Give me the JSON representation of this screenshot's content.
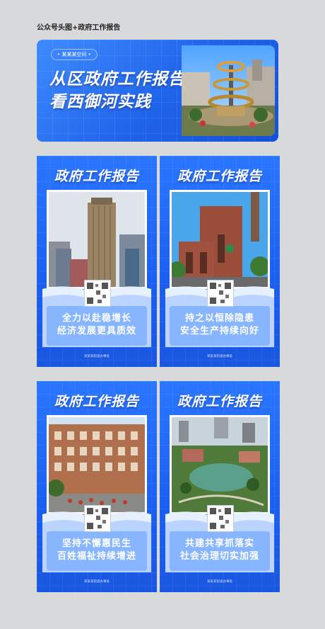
{
  "page_label": "公众号头图+政府工作报告",
  "banner": {
    "tag": "• 某某某空间 •",
    "title_line1": "从区政府工作报告",
    "title_line2": "看西御河实践"
  },
  "posters": [
    {
      "title": "政府工作报告",
      "line1": "全力以赴稳增长",
      "line2": "经济发展更具质效",
      "footer": "某某某街道办事处"
    },
    {
      "title": "政府工作报告",
      "line1": "持之以恒除隐患",
      "line2": "安全生产持续向好",
      "footer": "某某某街道办事处"
    },
    {
      "title": "政府工作报告",
      "line1": "坚持不懈惠民生",
      "line2": "百姓福祉持续增进",
      "footer": "某某某街道办事处"
    },
    {
      "title": "政府工作报告",
      "line1": "共建共享抓落实",
      "line2": "社会治理切实加强",
      "footer": "某某某街道办事处"
    }
  ]
}
